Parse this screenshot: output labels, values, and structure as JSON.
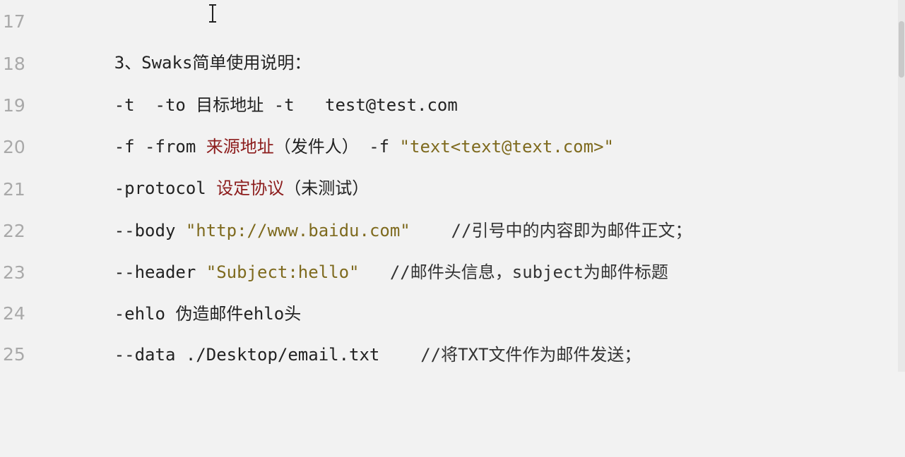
{
  "lines": [
    {
      "num": "17",
      "parts": [
        "3、Swaks简单使用说明："
      ]
    },
    {
      "num": "18",
      "parts": [
        "-t  -to ",
        "目标地址",
        " -t   test@test.com"
      ]
    },
    {
      "num": "19",
      "parts": [
        "-f -from ",
        "来源地址",
        "（发件人） -f ",
        "\"text<text@text.com>\""
      ]
    },
    {
      "num": "20",
      "parts": [
        "-protocol ",
        "设定协议",
        "（未测试）"
      ]
    },
    {
      "num": "21",
      "parts": [
        "--body ",
        "\"http://www.baidu.com\"",
        "    //引号中的内容即为邮件正文；"
      ]
    },
    {
      "num": "22",
      "parts": [
        "--header ",
        "\"Subject:hello\"",
        "   //邮件头信息，subject为邮件标题"
      ]
    },
    {
      "num": "23",
      "parts": [
        "-ehlo 伪造邮件ehlo头"
      ]
    },
    {
      "num": "24",
      "parts": [
        "--data ./Desktop/email.txt",
        "    //将TXT文件作为邮件发送；"
      ]
    },
    {
      "num": "25",
      "parts": [
        ""
      ]
    }
  ],
  "colors": {
    "background": "#f2f2f2",
    "line_number": "#a9a9a9",
    "text": "#222222",
    "string": "#7e6a1e",
    "chinese_highlight": "#8c1c1c"
  }
}
